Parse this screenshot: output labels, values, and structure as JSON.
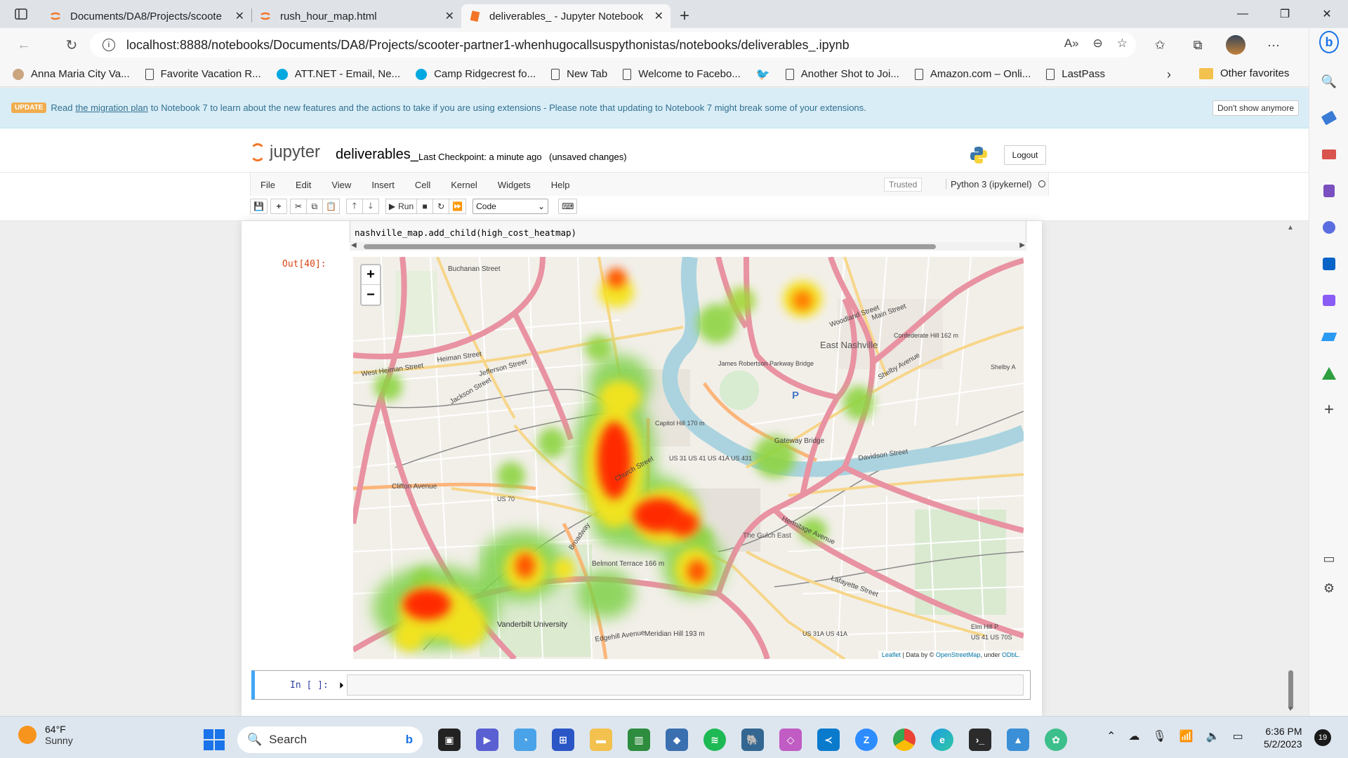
{
  "browser": {
    "tabs": [
      {
        "title": "Documents/DA8/Projects/scoote",
        "active": false
      },
      {
        "title": "rush_hour_map.html",
        "active": false
      },
      {
        "title": "deliverables_ - Jupyter Notebook",
        "active": true
      }
    ],
    "url": "localhost:8888/notebooks/Documents/DA8/Projects/scooter-partner1-whenhugocallsuspythonistas/notebooks/deliverables_.ipynb",
    "favorites": [
      "Anna Maria City Va...",
      "Favorite Vacation R...",
      "ATT.NET - Email, Ne...",
      "Camp Ridgecrest fo...",
      "New Tab",
      "Welcome to Facebo...",
      "Another Shot to Joi...",
      "Amazon.com – Onli...",
      "LastPass"
    ],
    "other_favorites": "Other favorites"
  },
  "banner": {
    "badge": "UPDATE",
    "text_before": "Read",
    "link": "the migration plan",
    "text_after": "to Notebook 7 to learn about the new features and the actions to take if you are using extensions - Please note that updating to Notebook 7 might break some of your extensions.",
    "dismiss": "Don't show anymore"
  },
  "jupyter": {
    "logo_text": "jupyter",
    "notebook_name": "deliverables_",
    "checkpoint": "Last Checkpoint: a minute ago",
    "unsaved": "(unsaved changes)",
    "logout": "Logout",
    "menu": [
      "File",
      "Edit",
      "View",
      "Insert",
      "Cell",
      "Kernel",
      "Widgets",
      "Help"
    ],
    "trusted": "Trusted",
    "kernel": "Python 3 (ipykernel)",
    "toolbar": {
      "run": "Run",
      "cell_type": "Code"
    }
  },
  "cells": {
    "code_line": "nashville_map.add_child(high_cost_heatmap)",
    "out_prompt": "Out[40]:",
    "in_prompt": "In [ ]:"
  },
  "map": {
    "zoom_in": "+",
    "zoom_out": "−",
    "attribution_leaflet": "Leaflet",
    "attribution_mid": "| Data by ©",
    "attribution_osm": "OpenStreetMap",
    "attribution_under": ", under",
    "attribution_odbl": "ODbL.",
    "labels": [
      "East Nashville",
      "Buchanan Street",
      "Jefferson Street",
      "Heiman Street",
      "West Heiman Street",
      "Clifton Avenue",
      "Church Street",
      "Broadway",
      "Belmont Terrace 166 m",
      "Vanderbilt University",
      "Meridian Hill 193 m",
      "The Gulch East",
      "Gateway Bridge",
      "Hermitage Avenue",
      "Lafayette Street",
      "Davidson Street",
      "Main Street",
      "Shelby Avenue",
      "Confederate Hill 162 m",
      "James Robertson Parkway Bridge",
      "Capitol Hill 170 m",
      "US 31 US 41 US 41A US 431",
      "US 70",
      "US 31A US 41A",
      "US 41 US 70S",
      "Edgehill Avenue",
      "Elm Hill P",
      "Shelby A",
      "Woodland Street",
      "Jackson Street"
    ]
  },
  "taskbar": {
    "temp": "64°F",
    "condition": "Sunny",
    "search": "Search",
    "time": "6:36 PM",
    "date": "5/2/2023",
    "notifications": "19"
  },
  "colors": {
    "jupyter_orange": "#f37626",
    "banner_bg": "#d9edf7",
    "heat_red": "#ff2a00",
    "heat_yellow": "#f5e31a",
    "heat_green": "#7fd14a"
  }
}
